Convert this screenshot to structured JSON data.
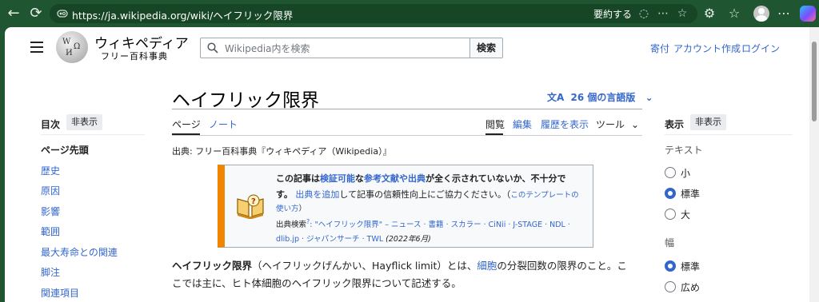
{
  "browser": {
    "url": "https://ja.wikipedia.org/wiki/ヘイフリック限界",
    "summarize_label": "要約する"
  },
  "header": {
    "logo_title": "ウィキペディア",
    "logo_subtitle": "フリー百科事典",
    "search_placeholder": "Wikipedia内を検索",
    "search_button": "検索",
    "links": [
      "寄付",
      "アカウント作成",
      "ログイン"
    ]
  },
  "article": {
    "title": "ヘイフリック限界",
    "languages_label": "26 個の言語版",
    "tabs_left": [
      "ページ",
      "ノート"
    ],
    "tabs_right": [
      "閲覧",
      "編集",
      "履歴を表示",
      "ツール"
    ],
    "source_line": "出典: フリー百科事典『ウィキペディア（Wikipedia）』",
    "notice": {
      "line1_a": "この記事は",
      "line1_link1": "検証可能",
      "line1_b": "な",
      "line1_link2": "参考文献や出典",
      "line1_c": "が全く示されていないか、不十分で",
      "line2_a": "す。",
      "line2_link": "出典を追加",
      "line2_b": "して記事の信頼性向上にご協力ください。（",
      "line2_link2": "このテンプレートの",
      "line3_link": "使い方",
      "line3_b": "）",
      "search_label": "出典検索",
      "search_q": "?",
      "search_terms": ": \"ヘイフリック限界\" – ニュース · 書籍 · スカラー · CiNii · J-STAGE · NDL ·",
      "search_terms2": "dlib.jp · ジャパンサーチ · TWL",
      "date": "(2022年6月)"
    },
    "para_line1_bold": "ヘイフリック限界",
    "para_line1_a": "（ヘイフリックげんかい、Hayflick limit）とは、",
    "para_line1_link": "細胞",
    "para_line1_b": "の分裂回数の限界のこと。こ",
    "para_line2": "こでは主に、ヒト体細胞のヘイフリック限界について記述する。"
  },
  "toc": {
    "title": "目次",
    "hide": "非表示",
    "head": "ページ先頭",
    "items": [
      "歴史",
      "原因",
      "影響",
      "範囲",
      "最大寿命との関連",
      "脚注",
      "関連項目"
    ]
  },
  "display": {
    "title": "表示",
    "hide": "非表示",
    "text_label": "テキスト",
    "text_options": [
      "小",
      "標準",
      "大"
    ],
    "text_selected": "標準",
    "width_label": "幅",
    "width_options": [
      "標準",
      "広め"
    ],
    "width_selected": "標準"
  }
}
